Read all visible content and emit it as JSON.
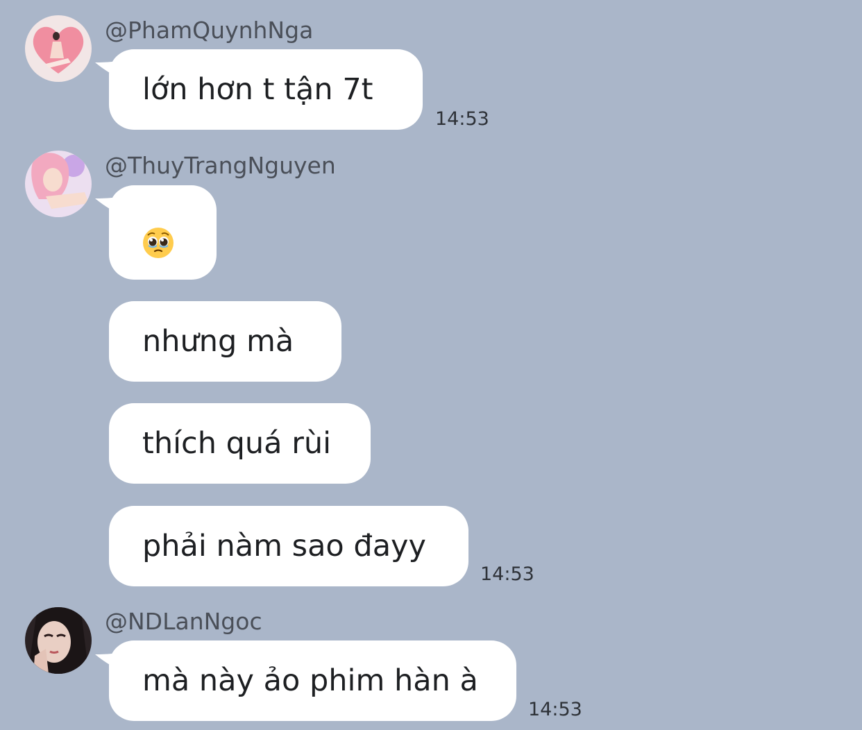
{
  "colors": {
    "background": "#aab6c9",
    "bubble": "#ffffff",
    "username": "#4a4f58",
    "text": "#1d1f22",
    "time": "#2e3238"
  },
  "messages": [
    {
      "username": "@PhamQuynhNga",
      "avatar": "avatar-pink-heart",
      "bubbles": [
        "lớn hơn t tận 7t"
      ],
      "time": "14:53"
    },
    {
      "username": "@ThuyTrangNguyen",
      "avatar": "avatar-pink-hair",
      "emoji": "pleading-face-icon",
      "bubbles": [
        "nhưng mà",
        "thích quá rùi",
        "phải nàm sao đayy"
      ],
      "time": "14:53"
    },
    {
      "username": "@NDLanNgoc",
      "avatar": "avatar-dark-hair",
      "bubbles": [
        "mà này ảo phim hàn à"
      ],
      "time": "14:53"
    }
  ]
}
